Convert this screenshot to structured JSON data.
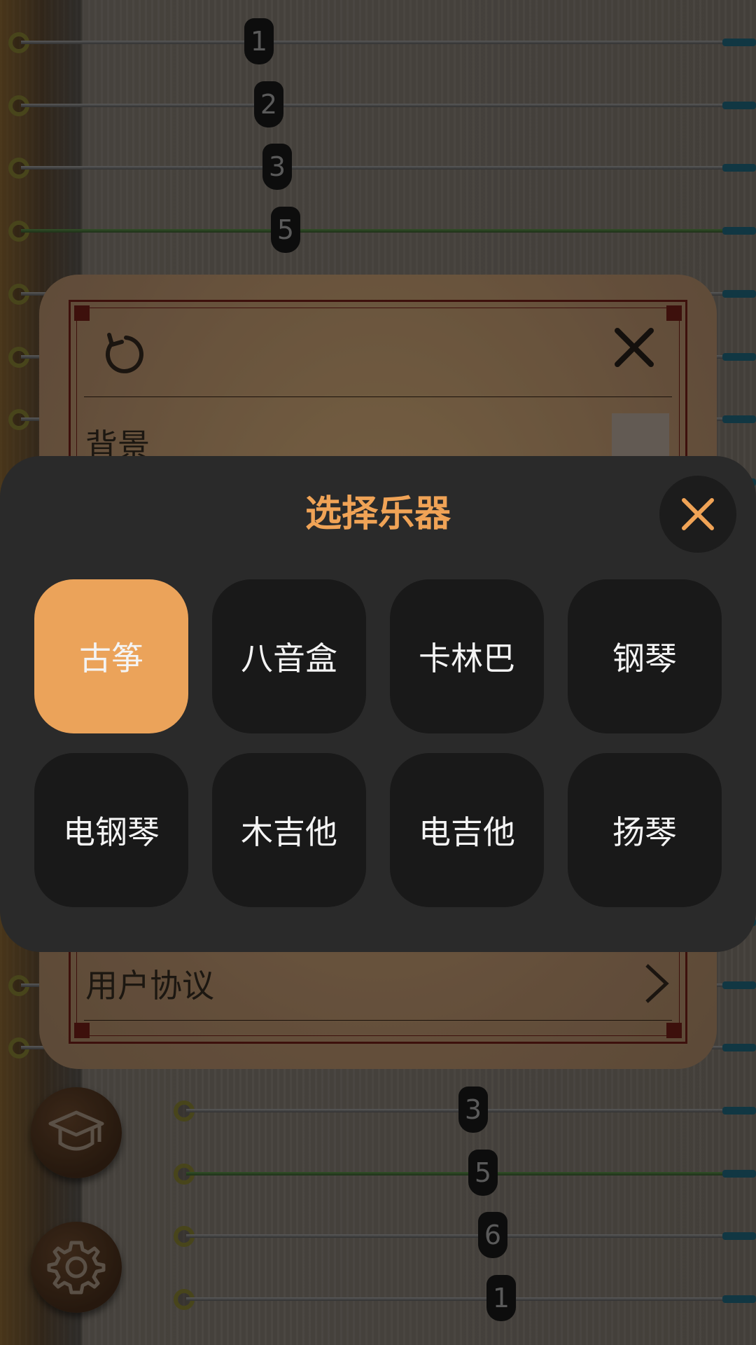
{
  "instrument_background": {
    "strings": [
      {
        "note": "1",
        "color": "gray",
        "has_bridge": true
      },
      {
        "note": "2",
        "color": "gray",
        "has_bridge": true
      },
      {
        "note": "3",
        "color": "gray",
        "has_bridge": true
      },
      {
        "note": "5",
        "color": "green",
        "has_bridge": true
      },
      {
        "note": "",
        "color": "gray",
        "has_bridge": false
      },
      {
        "note": "",
        "color": "gray",
        "has_bridge": false
      },
      {
        "note": "",
        "color": "gray",
        "has_bridge": false
      },
      {
        "note": "",
        "color": "gray",
        "has_bridge": false
      },
      {
        "note": "",
        "color": "gray",
        "has_bridge": false
      },
      {
        "note": "",
        "color": "gray",
        "has_bridge": false
      },
      {
        "note": "",
        "color": "gray",
        "has_bridge": false
      },
      {
        "note": "",
        "color": "gray",
        "has_bridge": false
      },
      {
        "note": "",
        "color": "gray",
        "has_bridge": false
      },
      {
        "note": "",
        "color": "gray",
        "has_bridge": false
      },
      {
        "note": "",
        "color": "gray",
        "has_bridge": false
      },
      {
        "note": "",
        "color": "gray",
        "has_bridge": false
      },
      {
        "note": "",
        "color": "gray",
        "has_bridge": false
      },
      {
        "note": "3",
        "color": "gray",
        "has_bridge": true
      },
      {
        "note": "5",
        "color": "green",
        "has_bridge": true
      },
      {
        "note": "6",
        "color": "gray",
        "has_bridge": true
      },
      {
        "note": "1",
        "color": "gray",
        "has_bridge": true
      }
    ],
    "side_buttons": [
      {
        "icon": "graduation-cap-icon"
      },
      {
        "icon": "gear-icon"
      }
    ]
  },
  "settings_panel": {
    "reset_icon": "refresh-icon",
    "close_icon": "close-icon",
    "background_label": "背景",
    "agreement_label": "用户协议",
    "agreement_chevron": "chevron-right-icon"
  },
  "picker": {
    "title": "选择乐器",
    "close_icon": "close-icon",
    "instruments": [
      "古筝",
      "八音盒",
      "卡林巴",
      "钢琴",
      "电钢琴",
      "木吉他",
      "电吉他",
      "扬琴"
    ],
    "selected_index": 0,
    "colors": {
      "accent": "#F0A356",
      "selected_tile": "#EBA35A",
      "tile": "#191919",
      "sheet": "#2A2A2A"
    }
  }
}
